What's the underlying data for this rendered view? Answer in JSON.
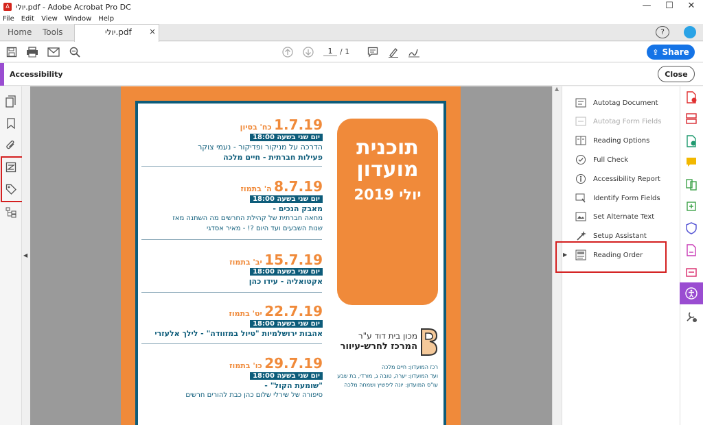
{
  "app": {
    "title": "יולי.pdf - Adobe Acrobat Pro DC",
    "menu": [
      "File",
      "Edit",
      "View",
      "Window",
      "Help"
    ],
    "tabs": {
      "home": "Home",
      "tools": "Tools",
      "doc": "יולי.pdf"
    }
  },
  "toolbar": {
    "page_current": "1",
    "page_total": "/ 1",
    "share_label": "Share"
  },
  "panel": {
    "title": "Accessibility",
    "close_label": "Close"
  },
  "right_panel": {
    "items": [
      {
        "label": "Autotag Document",
        "icon": "autotag-icon",
        "enabled": true
      },
      {
        "label": "Autotag Form Fields",
        "icon": "autotag-form-icon",
        "enabled": false
      },
      {
        "label": "Reading Options",
        "icon": "reading-options-icon",
        "enabled": true
      },
      {
        "label": "Full Check",
        "icon": "check-circle-icon",
        "enabled": true
      },
      {
        "label": "Accessibility Report",
        "icon": "report-icon",
        "enabled": true
      },
      {
        "label": "Identify Form Fields",
        "icon": "form-fields-icon",
        "enabled": true
      },
      {
        "label": "Set Alternate Text",
        "icon": "alt-text-icon",
        "enabled": true
      },
      {
        "label": "Setup Assistant",
        "icon": "wand-icon",
        "enabled": true
      },
      {
        "label": "Reading Order",
        "icon": "reading-order-icon",
        "enabled": true
      }
    ]
  },
  "pdf": {
    "title_line1": "תוכנית",
    "title_line2": "מועדון",
    "title_line3": "יולי 2019",
    "events": [
      {
        "date": "1.7.19",
        "hebrew": "כח' בסיון",
        "time": "יום שני בשעה 18:00",
        "line1": "הדרכה על מניקור ופדיקור - נעמי צוקר",
        "line2": "פעילות חברתית - חיים מלכה",
        "line3": ""
      },
      {
        "date": "8.7.19",
        "hebrew": "ה' בתמוז",
        "time": "יום שני בשעה 18:00",
        "line1": "מאבק הנכים -",
        "line2": "מחאה חברתית של קהילת החרשים מה השתנה מאז",
        "line3": "שנות השבעים ועד היום ?! - מאיר אסדגי"
      },
      {
        "date": "15.7.19",
        "hebrew": "יב' בתמוז",
        "time": "יום שני בשעה 18:00",
        "line1": "אקטואליה - עידו כהן",
        "line2": "",
        "line3": ""
      },
      {
        "date": "22.7.19",
        "hebrew": "יט' בתמוז",
        "time": "יום שני בשעה 18:00",
        "line1": "אהבות ירושלמיות \"טיול במזוודה\" - לילך אלעזרי",
        "line2": "",
        "line3": ""
      },
      {
        "date": "29.7.19",
        "hebrew": "כו' בתמוז",
        "time": "יום שני בשעה 18:00",
        "line1": "\"שומעת הקול\" -",
        "line2": "סיפורה של שירלי שלום כהן כבת להורים חרשים",
        "line3": ""
      }
    ],
    "org_line1": "מכון בית דוד ע\"ר",
    "org_line2": "המרכז לחרש-עיוור",
    "credits": [
      "רכז המועדון: חיים מלכה",
      "ועד המועדון: יערה, טובה ג, מורדי, בת שבע",
      "עו\"ס המועדון: יונה ליפשיץ ושמחה מלכה"
    ]
  },
  "colors": {
    "accent": "#1473e6",
    "panel_bar": "#9a4dd1",
    "highlight": "#d41f1f",
    "pdf_orange": "#f08a3a",
    "pdf_teal": "#0d5c7a"
  }
}
